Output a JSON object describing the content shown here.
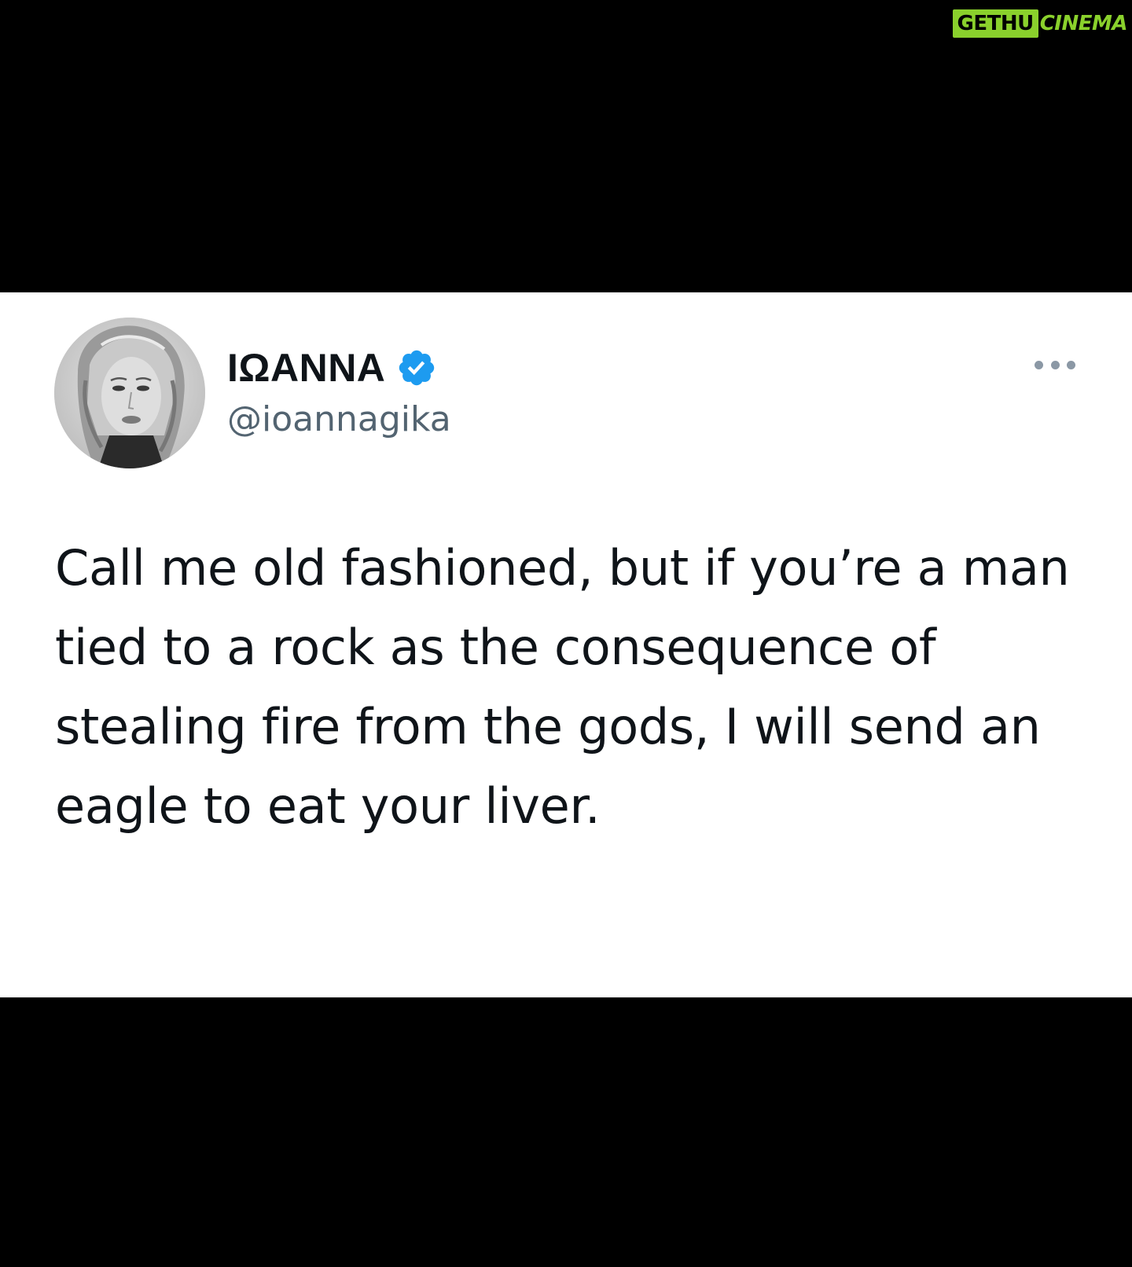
{
  "watermark": {
    "boxed": "GETHU",
    "rest": "CINEMA"
  },
  "tweet": {
    "display_name": "ΙΩΑΝΝΑ",
    "handle": "@ioannagika",
    "text": "Call me old fashioned, but if you’re a man tied to a rock as the consequence of stealing fire from the gods, I will send an eagle to eat your liver.",
    "verified": true,
    "more_icon": "more-horizontal-icon"
  },
  "colors": {
    "background": "#000000",
    "card": "#ffffff",
    "verified_badge": "#1d9bf0",
    "handle": "#536471",
    "text": "#0f1419",
    "watermark": "#8ad12c"
  }
}
